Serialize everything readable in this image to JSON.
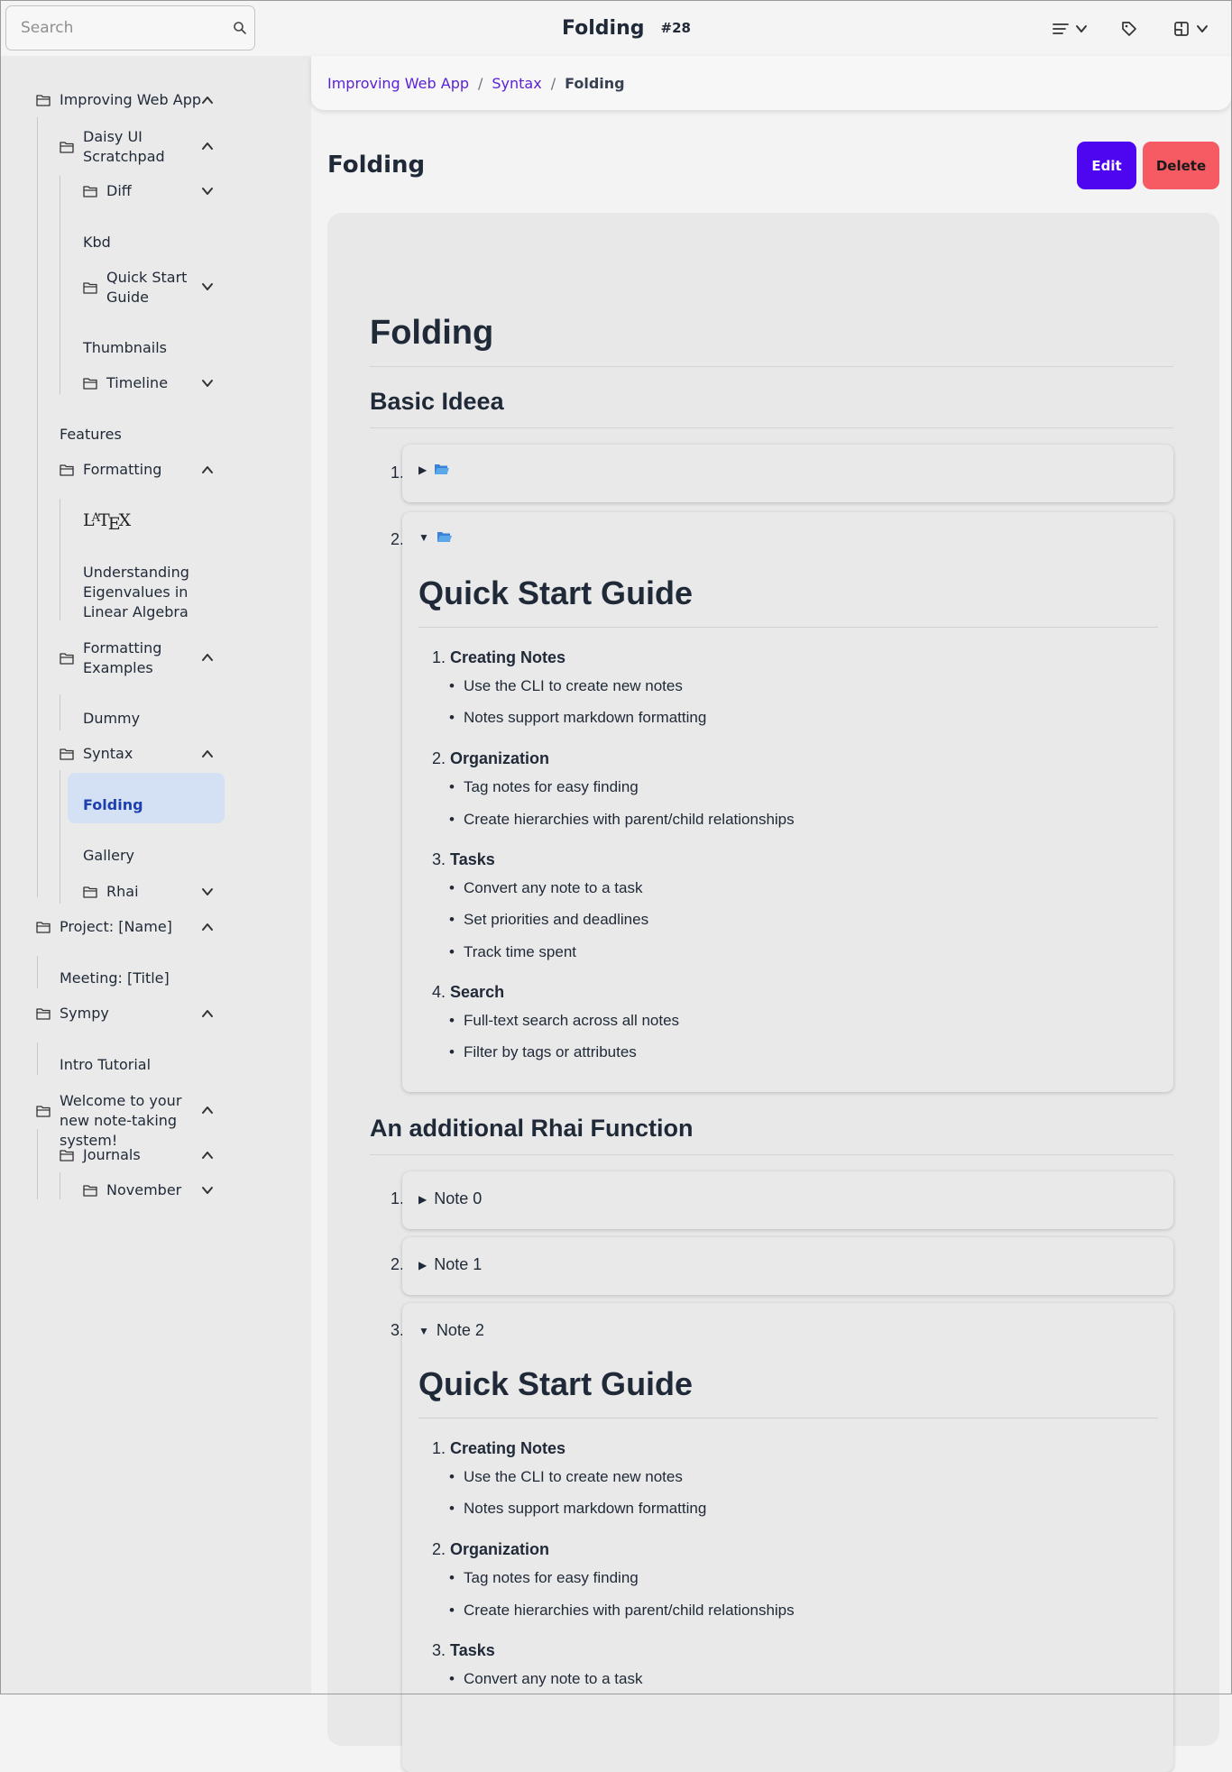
{
  "header": {
    "search_placeholder": "Search",
    "title": "Folding",
    "note_id": "#28",
    "icons": [
      "search-icon",
      "list-menu-icon",
      "chevron-down-icon",
      "tag-icon",
      "theme-icon"
    ]
  },
  "sidebar": {
    "items": [
      {
        "label": "Improving Web App",
        "folder": true,
        "expanded": true
      },
      {
        "label": "Daisy UI Scratchpad",
        "folder": true,
        "expanded": true
      },
      {
        "label": "Diff",
        "folder": true,
        "expanded": false
      },
      {
        "label": "Kbd",
        "folder": false
      },
      {
        "label": "Quick Start Guide",
        "folder": true,
        "expanded": false
      },
      {
        "label": "Thumbnails",
        "folder": false
      },
      {
        "label": "Timeline",
        "folder": true,
        "expanded": false
      },
      {
        "label": "Features",
        "folder": false
      },
      {
        "label": "Formatting",
        "folder": true,
        "expanded": true
      },
      {
        "label": "LaTeX",
        "folder": false
      },
      {
        "label": "Understanding Eigenvalues in Linear Algebra",
        "folder": false
      },
      {
        "label": "Formatting Examples",
        "folder": true,
        "expanded": true
      },
      {
        "label": "Dummy",
        "folder": false
      },
      {
        "label": "Syntax",
        "folder": true,
        "expanded": true
      },
      {
        "label": "Folding",
        "folder": false,
        "active": true
      },
      {
        "label": "Gallery",
        "folder": false
      },
      {
        "label": "Rhai",
        "folder": true,
        "expanded": false
      },
      {
        "label": "Project: [Name]",
        "folder": true,
        "expanded": true
      },
      {
        "label": "Meeting: [Title]",
        "folder": false
      },
      {
        "label": "Sympy",
        "folder": true,
        "expanded": true
      },
      {
        "label": "Intro Tutorial",
        "folder": false
      },
      {
        "label": "Welcome to your new note-taking system!",
        "folder": true,
        "expanded": true
      },
      {
        "label": "Journals",
        "folder": true,
        "expanded": true
      },
      {
        "label": "November",
        "folder": true,
        "expanded": false
      }
    ]
  },
  "breadcrumb": {
    "items": [
      "Improving Web App",
      "Syntax"
    ],
    "current": "Folding",
    "separator": "/"
  },
  "page": {
    "title": "Folding",
    "edit_label": "Edit",
    "delete_label": "Delete"
  },
  "note": {
    "h1": "Folding",
    "section1": "Basic Ideea",
    "section2": "An additional Rhai Function",
    "item_numbers": [
      "1.",
      "2.",
      "3."
    ],
    "basic_items": [
      {
        "expanded": false,
        "icon": "folder-open-icon"
      },
      {
        "expanded": true,
        "icon": "folder-open-icon"
      }
    ],
    "rhai_items": [
      {
        "label": "Note 0",
        "expanded": false
      },
      {
        "label": "Note 1",
        "expanded": false
      },
      {
        "label": "Note 2",
        "expanded": true
      }
    ],
    "guide": {
      "title": "Quick Start Guide",
      "sections": [
        {
          "num": "1.",
          "title": "Creating Notes",
          "bullets": [
            "Use the CLI to create new notes",
            "Notes support markdown formatting"
          ]
        },
        {
          "num": "2.",
          "title": "Organization",
          "bullets": [
            "Tag notes for easy finding",
            "Create hierarchies with parent/child relationships"
          ]
        },
        {
          "num": "3.",
          "title": "Tasks",
          "bullets": [
            "Convert any note to a task",
            "Set priorities and deadlines",
            "Track time spent"
          ]
        },
        {
          "num": "4.",
          "title": "Search",
          "bullets": [
            "Full-text search across all notes",
            "Filter by tags or attributes"
          ]
        }
      ]
    }
  },
  "colors": {
    "accent": "#4e05f0",
    "danger": "#f65a63",
    "link": "#5b21d6",
    "active_item_bg": "#d4e1f5",
    "active_item_text": "#1e40af"
  }
}
